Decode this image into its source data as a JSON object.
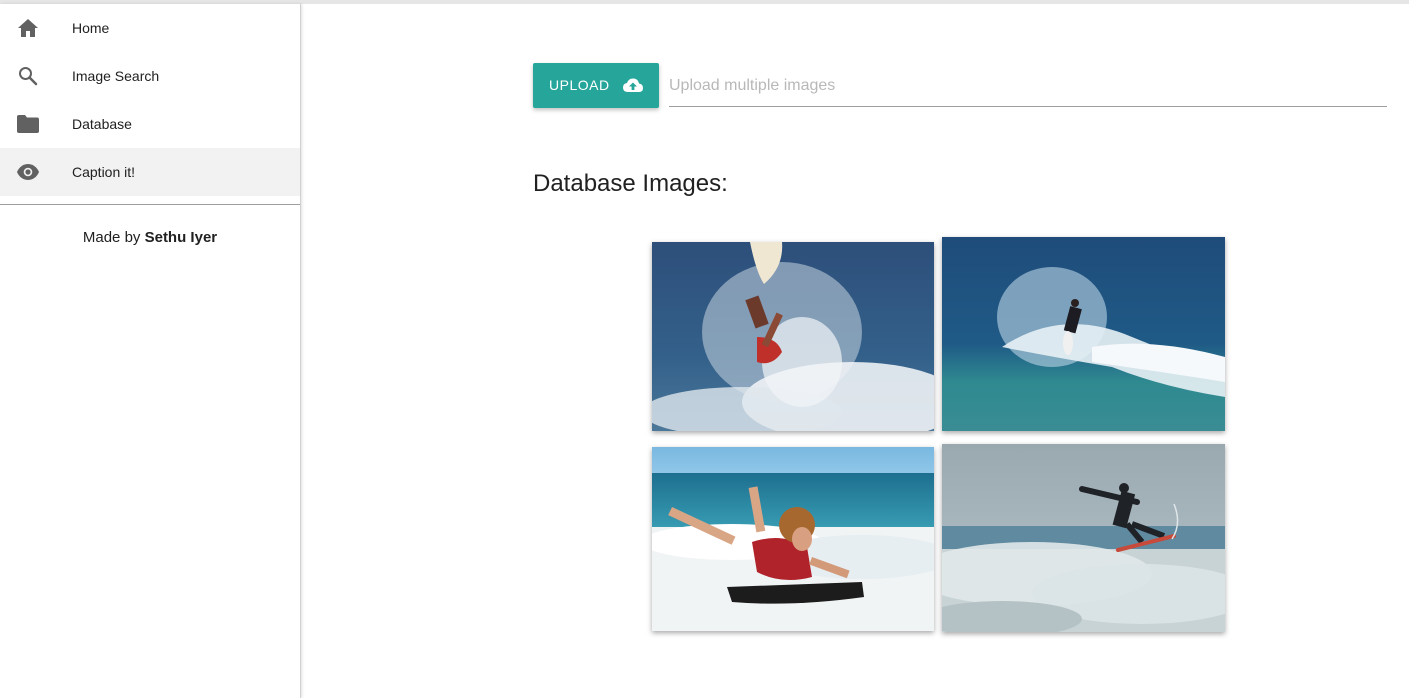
{
  "sidebar": {
    "items": [
      {
        "label": "Home",
        "icon": "home-icon"
      },
      {
        "label": "Image Search",
        "icon": "search-icon"
      },
      {
        "label": "Database",
        "icon": "folder-icon"
      },
      {
        "label": "Caption it!",
        "icon": "eye-icon"
      }
    ],
    "active_item": "Caption it!",
    "credit_prefix": "Made by",
    "credit_name": "Sethu Iyer"
  },
  "upload": {
    "button_label": "UPLOAD",
    "button_icon": "cloud-upload-icon",
    "input_placeholder": "Upload multiple images",
    "input_value": ""
  },
  "main": {
    "section_title": "Database Images:"
  },
  "colors": {
    "accent": "#26a69a",
    "active_nav_bg": "#f2f2f2",
    "icon_gray": "#616161"
  }
}
